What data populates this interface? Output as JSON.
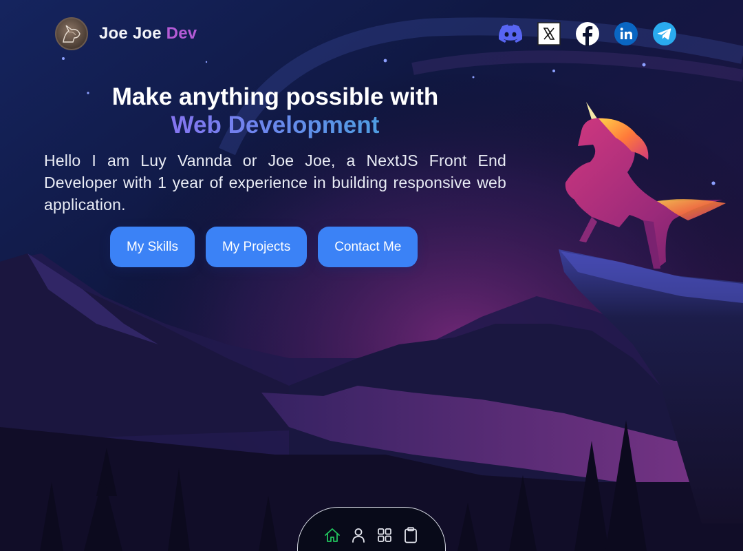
{
  "brand": {
    "name_primary": "Joe Joe",
    "name_accent": "Dev",
    "logo_icon": "unicorn-head-icon"
  },
  "socials": [
    {
      "name": "discord",
      "icon": "discord-icon",
      "color": "#5865F2"
    },
    {
      "name": "x",
      "icon": "x-icon",
      "color": "#FFFFFF"
    },
    {
      "name": "facebook",
      "icon": "facebook-icon",
      "color": "#FFFFFF"
    },
    {
      "name": "linkedin",
      "icon": "linkedin-icon",
      "color": "#0A66C2"
    },
    {
      "name": "telegram",
      "icon": "telegram-icon",
      "color": "#2AABEE"
    }
  ],
  "hero": {
    "title": "Make anything possible with",
    "title_accent": "Web Development",
    "description": "Hello I am Luy Vannda or Joe Joe, a NextJS Front End Developer with 1 year of experience in building responsive web application."
  },
  "cta": {
    "skills": "My Skills",
    "projects": "My Projects",
    "contact": "Contact Me"
  },
  "dock": [
    {
      "icon": "home-icon",
      "active": true
    },
    {
      "icon": "user-icon",
      "active": false
    },
    {
      "icon": "grid-icon",
      "active": false
    },
    {
      "icon": "clipboard-icon",
      "active": false
    }
  ],
  "colors": {
    "accent_button": "#3B82F6",
    "brand_accent": "#B45BD6",
    "dock_active": "#22C55E"
  }
}
